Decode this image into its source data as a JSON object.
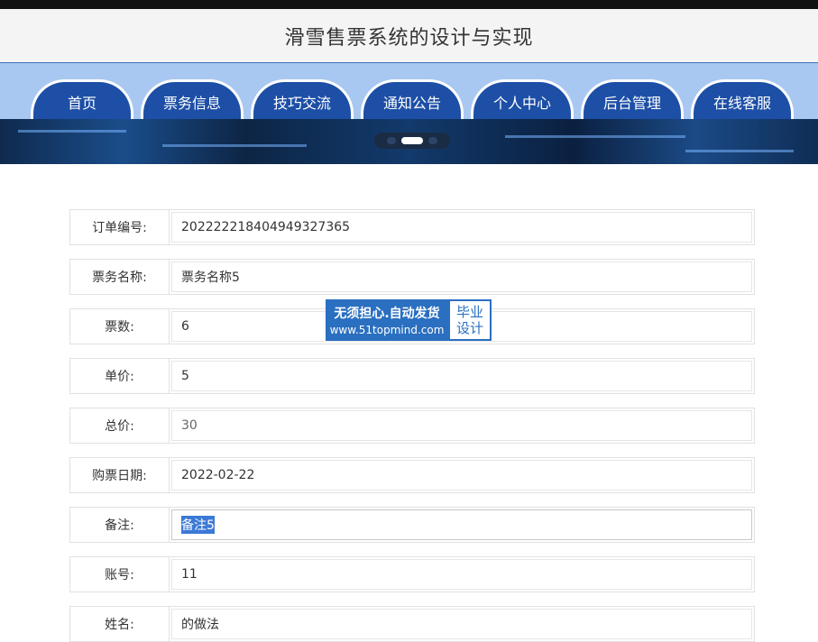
{
  "app": {
    "title": "滑雪售票系统的设计与实现"
  },
  "nav": {
    "items": [
      {
        "label": "首页"
      },
      {
        "label": "票务信息"
      },
      {
        "label": "技巧交流"
      },
      {
        "label": "通知公告"
      },
      {
        "label": "个人中心"
      },
      {
        "label": "后台管理"
      },
      {
        "label": "在线客服"
      }
    ]
  },
  "form": {
    "fields": [
      {
        "label": "订单编号:",
        "value": "202222218404949327365"
      },
      {
        "label": "票务名称:",
        "value": "票务名称5"
      },
      {
        "label": "票数:",
        "value": "6"
      },
      {
        "label": "单价:",
        "value": "5"
      },
      {
        "label": "总价:",
        "value": "30"
      },
      {
        "label": "购票日期:",
        "value": "2022-02-22"
      },
      {
        "label": "备注:",
        "value": "备注5"
      },
      {
        "label": "账号:",
        "value": "11"
      },
      {
        "label": "姓名:",
        "value": "的做法"
      }
    ]
  },
  "watermark": {
    "line1": "无须担心.自动发货",
    "line2": "www.51topmind.com",
    "badge_top": "毕业",
    "badge_bottom": "设计"
  },
  "colors": {
    "nav_bg": "#1d4fa6",
    "nav_band": "#a9c8f1",
    "selection": "#3b79d6"
  }
}
